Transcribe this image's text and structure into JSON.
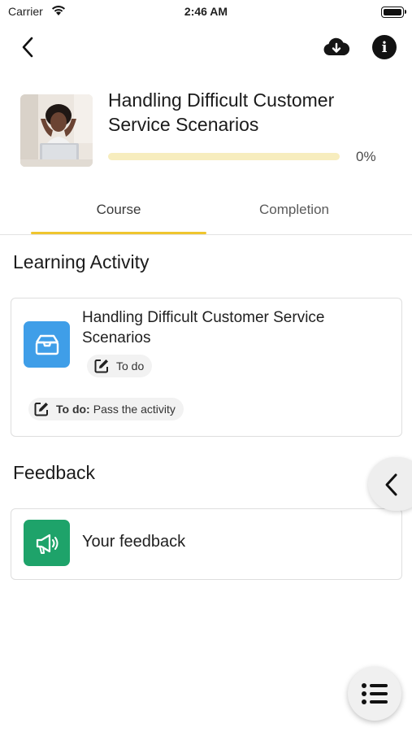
{
  "status_bar": {
    "carrier": "Carrier",
    "time": "2:46 AM"
  },
  "header": {
    "back_icon": "chevron-left-icon",
    "download_icon": "cloud-download-icon",
    "info_icon": "info-icon"
  },
  "course": {
    "title": "Handling Difficult Customer Service Scenarios",
    "progress": 0,
    "progress_label": "0%",
    "thumbnail": "stressed-person-at-laptop-photo"
  },
  "tabs": [
    {
      "label": "Course",
      "active": true
    },
    {
      "label": "Completion",
      "active": false
    }
  ],
  "learning_activity": {
    "section_title": "Learning Activity",
    "item": {
      "title": "Handling Difficult Customer Service Scenarios",
      "icon": "box-icon",
      "status": "To do",
      "requirement_label": "To do:",
      "requirement_text": "Pass the activity"
    }
  },
  "feedback": {
    "section_title": "Feedback",
    "item": {
      "label": "Your feedback",
      "icon": "megaphone-icon"
    }
  },
  "colors": {
    "accent": "#efc52e",
    "activity_icon_bg": "#3f9ee8",
    "feedback_icon_bg": "#1ea36a"
  }
}
